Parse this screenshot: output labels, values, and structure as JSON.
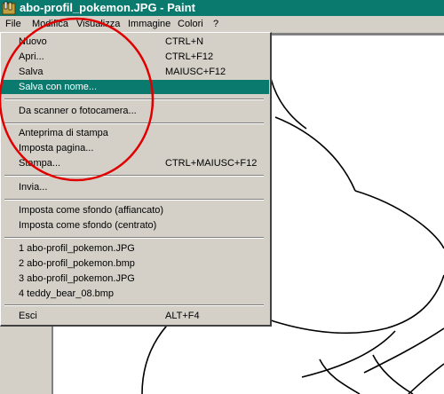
{
  "window": {
    "title": "abo-profil_pokemon.JPG - Paint",
    "icon": "paint-app-icon"
  },
  "menubar": [
    "File",
    "Modifica",
    "Visualizza",
    "Immagine",
    "Colori",
    "?"
  ],
  "file_menu": {
    "items": [
      {
        "label": "Nuovo",
        "shortcut": "CTRL+N"
      },
      {
        "label": "Apri...",
        "shortcut": "CTRL+F12"
      },
      {
        "label": "Salva",
        "shortcut": "MAIUSC+F12"
      },
      {
        "label": "Salva con nome...",
        "shortcut": ""
      },
      {
        "label": "Da scanner o fotocamera...",
        "shortcut": ""
      },
      {
        "label": "Anteprima di stampa",
        "shortcut": ""
      },
      {
        "label": "Imposta pagina...",
        "shortcut": ""
      },
      {
        "label": "Stampa...",
        "shortcut": "CTRL+MAIUSC+F12"
      },
      {
        "label": "Invia...",
        "shortcut": ""
      },
      {
        "label": "Imposta come sfondo (affiancato)",
        "shortcut": ""
      },
      {
        "label": "Imposta come sfondo (centrato)",
        "shortcut": ""
      },
      {
        "label": "1 abo-profil_pokemon.JPG",
        "shortcut": ""
      },
      {
        "label": "2 abo-profil_pokemon.bmp",
        "shortcut": ""
      },
      {
        "label": "3 abo-profil_pokemon.JPG",
        "shortcut": ""
      },
      {
        "label": "4 teddy_bear_08.bmp",
        "shortcut": ""
      },
      {
        "label": "Esci",
        "shortcut": "ALT+F4"
      }
    ],
    "highlighted": "Salva con nome..."
  },
  "colors": {
    "title_bar": "#0a7a6e",
    "highlight": "#0a7a6e",
    "face": "#d4d0c8",
    "annotation": "#e00000"
  }
}
